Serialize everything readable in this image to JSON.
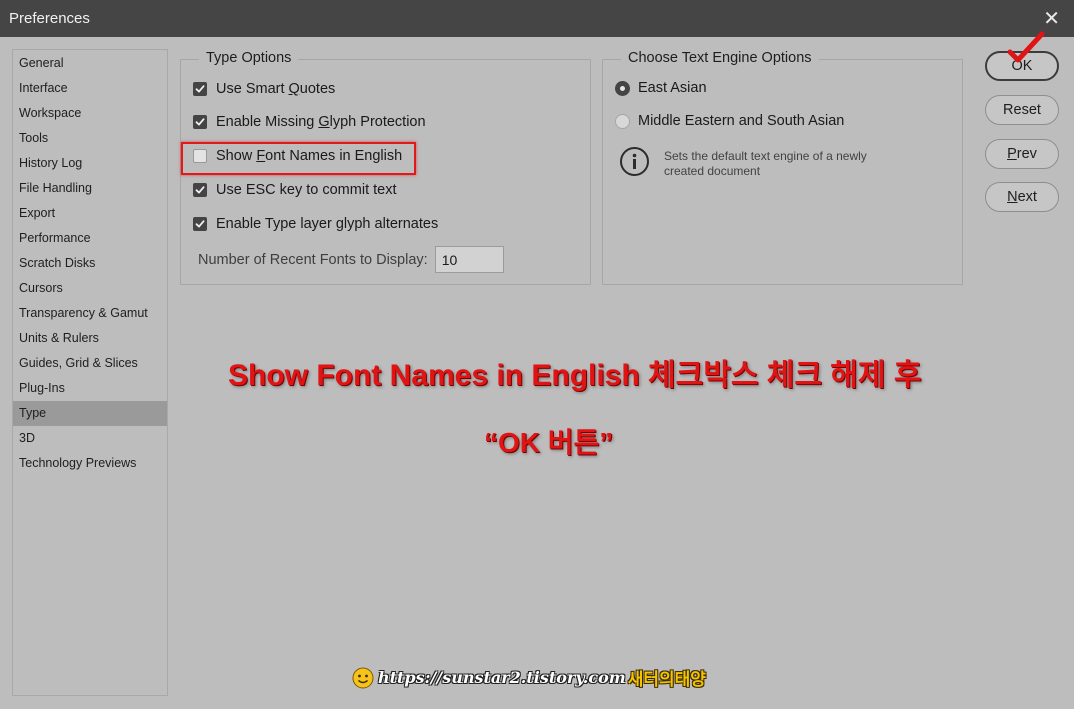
{
  "window": {
    "title": "Preferences",
    "close_glyph": "✕"
  },
  "sidebar": {
    "items": [
      {
        "label": "General",
        "selected": false
      },
      {
        "label": "Interface",
        "selected": false
      },
      {
        "label": "Workspace",
        "selected": false
      },
      {
        "label": "Tools",
        "selected": false
      },
      {
        "label": "History Log",
        "selected": false
      },
      {
        "label": "File Handling",
        "selected": false
      },
      {
        "label": "Export",
        "selected": false
      },
      {
        "label": "Performance",
        "selected": false
      },
      {
        "label": "Scratch Disks",
        "selected": false
      },
      {
        "label": "Cursors",
        "selected": false
      },
      {
        "label": "Transparency & Gamut",
        "selected": false
      },
      {
        "label": "Units & Rulers",
        "selected": false
      },
      {
        "label": "Guides, Grid & Slices",
        "selected": false
      },
      {
        "label": "Plug-Ins",
        "selected": false
      },
      {
        "label": "Type",
        "selected": true
      },
      {
        "label": "3D",
        "selected": false
      },
      {
        "label": "Technology Previews",
        "selected": false
      }
    ]
  },
  "type_options": {
    "title": "Type Options",
    "checkboxes": [
      {
        "label_pre": "Use Smart ",
        "label_u": "Q",
        "label_post": "uotes",
        "checked": true
      },
      {
        "label_pre": "Enable Missing ",
        "label_u": "G",
        "label_post": "lyph Protection",
        "checked": true
      },
      {
        "label_pre": "Show ",
        "label_u": "F",
        "label_post": "ont Names in English",
        "checked": false
      },
      {
        "label_pre": "Use ESC key to commit text",
        "label_u": "",
        "label_post": "",
        "checked": true
      },
      {
        "label_pre": "Enable Type layer glyph alternates",
        "label_u": "",
        "label_post": "",
        "checked": true
      }
    ],
    "recent_fonts_label": "Number of Recent Fonts to Display:",
    "recent_fonts_value": "10"
  },
  "engine_options": {
    "title": "Choose Text Engine Options",
    "radios": [
      {
        "label": "East Asian",
        "selected": true
      },
      {
        "label": "Middle Eastern and South Asian",
        "selected": false
      }
    ],
    "info_text": "Sets the default text engine of a newly created document"
  },
  "buttons": {
    "ok": "OK",
    "reset": "Reset",
    "prev_u": "P",
    "prev_rest": "rev",
    "next_u": "N",
    "next_rest": "ext"
  },
  "annotation": {
    "line1": "Show Font Names in English 체크박스 체크 해제 후",
    "line2": "“OK 버튼”",
    "color": "#e01414"
  },
  "watermark": {
    "url": "https://sunstar2.tistory.com",
    "name": "새터의태양"
  }
}
